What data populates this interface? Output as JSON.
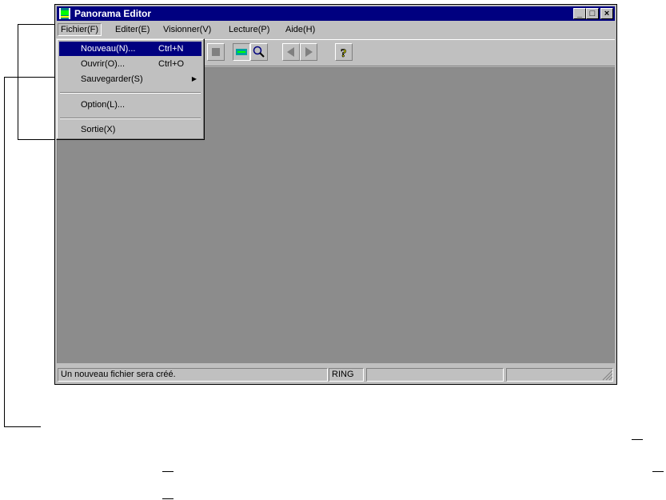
{
  "window": {
    "title": "Panorama Editor",
    "controls": {
      "minimize": "_",
      "maximize": "□",
      "close": "×"
    }
  },
  "menubar": {
    "items": [
      {
        "label": "Fichier(F)"
      },
      {
        "label": "Editer(E)"
      },
      {
        "label": "Visionner(V)"
      },
      {
        "label": "Lecture(P)"
      },
      {
        "label": "Aide(H)"
      }
    ]
  },
  "file_menu": {
    "items": [
      {
        "label": "Nouveau(N)...",
        "shortcut": "Ctrl+N",
        "highlighted": true
      },
      {
        "label": "Ouvrir(O)...",
        "shortcut": "Ctrl+O"
      },
      {
        "label": "Sauvegarder(S)",
        "submenu_arrow": "▶"
      },
      {
        "label": "Option(L)..."
      },
      {
        "label": "Sortie(X)"
      }
    ]
  },
  "toolbar": {
    "icons": [
      "new-icon",
      "open-icon",
      "save-icon",
      "stop-icon",
      "panorama-view-icon",
      "zoom-icon",
      "prev-icon",
      "next-icon",
      "help-icon"
    ]
  },
  "statusbar": {
    "message": "Un nouveau fichier sera créé.",
    "mode": "RING",
    "pane3": "",
    "pane4": ""
  },
  "colors": {
    "title_bg": "#000080",
    "face": "#c0c0c0",
    "client_bg": "#8c8c8c",
    "highlight": "#000080"
  }
}
